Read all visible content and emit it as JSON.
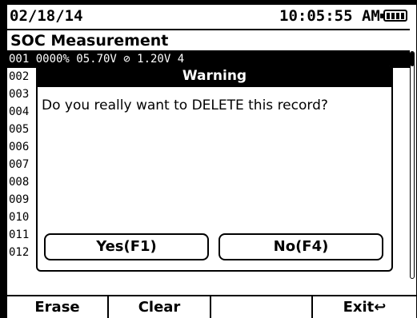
{
  "status": {
    "date": "02/18/14",
    "time": "10:05:55 AM",
    "battery_icon": "battery-full-icon"
  },
  "screen_title": "SOC Measurement",
  "records": [
    {
      "id": "001",
      "text": "001  0000%  05.70V        ⊘     1.20V  4",
      "selected": true
    },
    {
      "id": "002",
      "text": "002"
    },
    {
      "id": "003",
      "text": "003"
    },
    {
      "id": "004",
      "text": "004"
    },
    {
      "id": "005",
      "text": "005"
    },
    {
      "id": "006",
      "text": "006"
    },
    {
      "id": "007",
      "text": "007"
    },
    {
      "id": "008",
      "text": "008"
    },
    {
      "id": "009",
      "text": "009"
    },
    {
      "id": "010",
      "text": "010"
    },
    {
      "id": "011",
      "text": "011"
    },
    {
      "id": "012",
      "text": "012"
    }
  ],
  "dialog": {
    "title": "Warning",
    "message": "Do you really want to DELETE this record?",
    "yes_label": "Yes(F1)",
    "no_label": "No(F4)"
  },
  "softkeys": {
    "f1": "Erase",
    "f2": "Clear",
    "f3": "",
    "f4": "Exit↩"
  },
  "colors": {
    "background": "#ffffff",
    "foreground": "#000000"
  }
}
